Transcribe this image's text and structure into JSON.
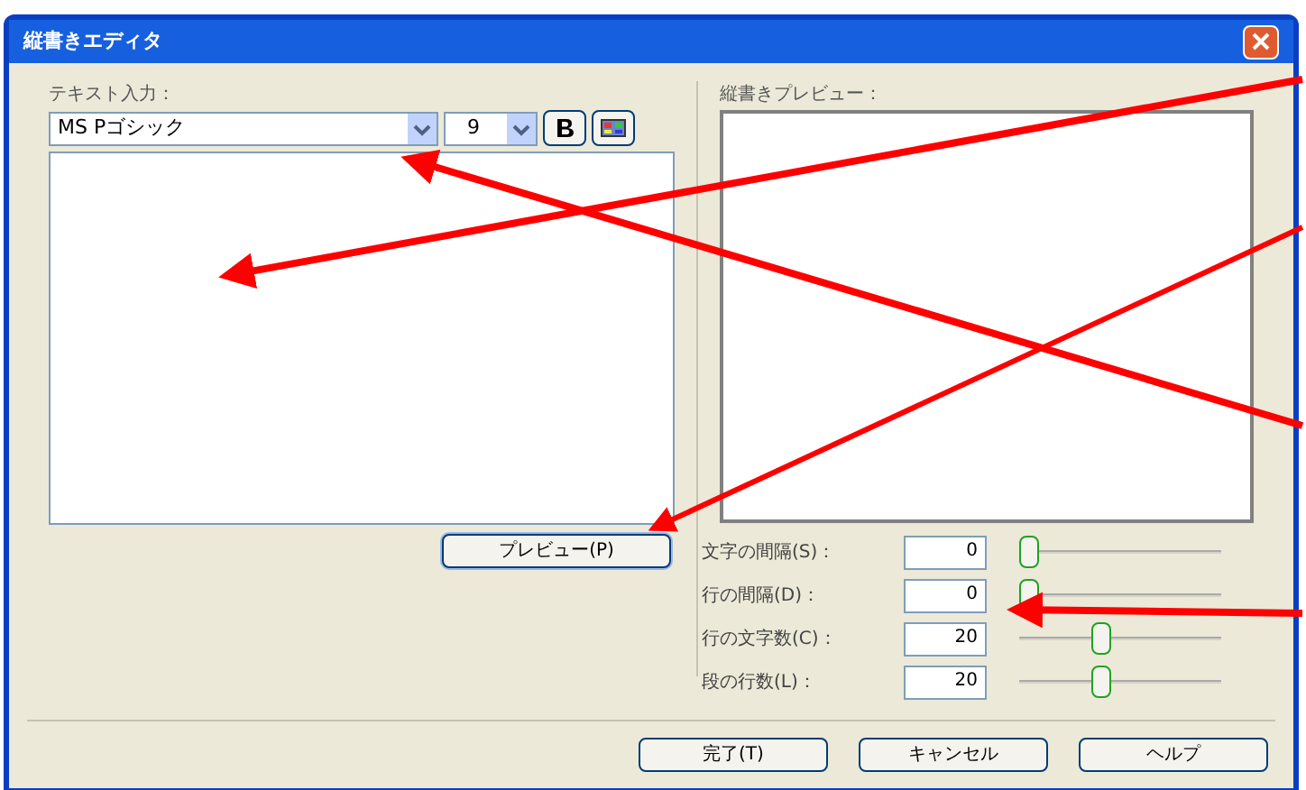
{
  "window": {
    "title": "縦書きエディタ"
  },
  "text_input": {
    "label": "テキスト入力：",
    "font": "MS Pゴシック",
    "size": "9",
    "bold": false
  },
  "preview": {
    "label": "縦書きプレビュー：",
    "button": "プレビュー(P)"
  },
  "settings": [
    {
      "label": "文字の間隔(S)：",
      "value": "0",
      "level": 0.0
    },
    {
      "label": "行の間隔(D)：",
      "value": "0",
      "level": 0.0
    },
    {
      "label": "行の文字数(C)：",
      "value": "20",
      "level": 0.4
    },
    {
      "label": "段の行数(L)：",
      "value": "20",
      "level": 0.4
    }
  ],
  "buttons": [
    "完了(T)",
    "キャンセル",
    "ヘルプ"
  ]
}
